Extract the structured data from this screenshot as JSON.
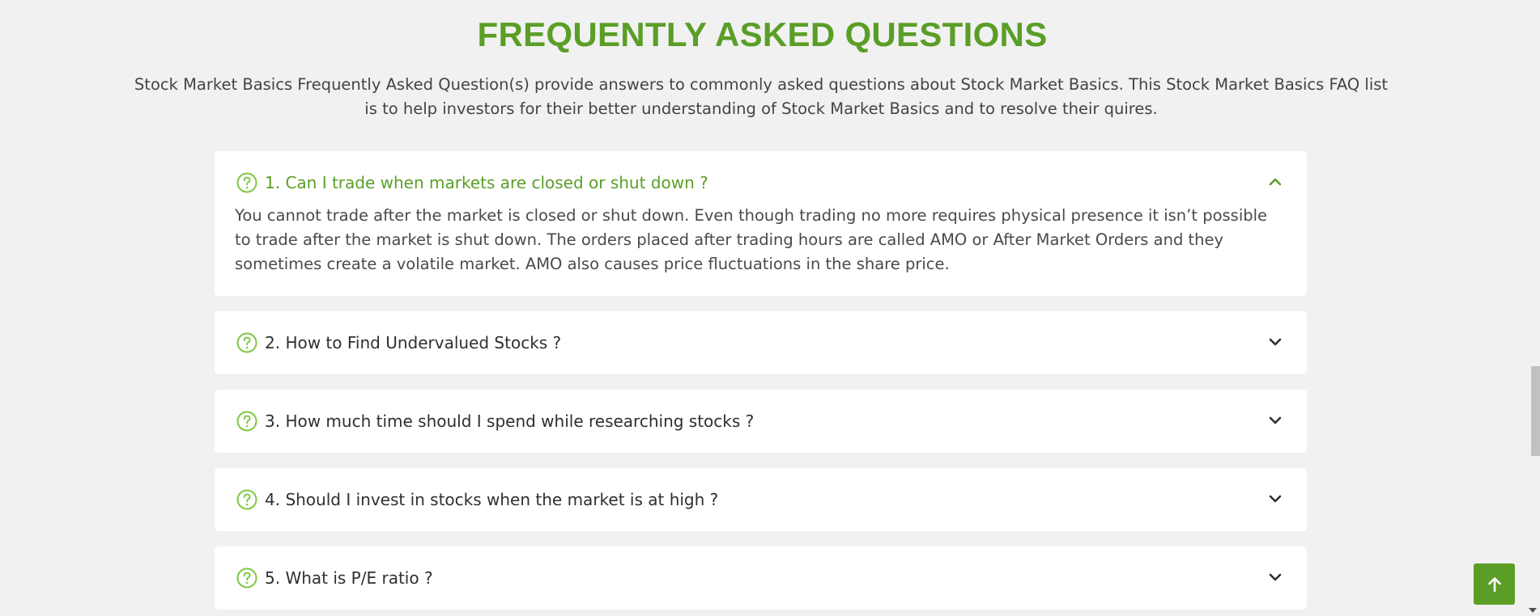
{
  "faq": {
    "title": "FREQUENTLY ASKED QUESTIONS",
    "intro": "Stock Market Basics Frequently Asked Question(s) provide answers to commonly asked questions about Stock Market Basics. This Stock Market Basics FAQ list is to help investors for their better understanding of Stock Market Basics and to resolve their quires.",
    "items": [
      {
        "question": "1. Can I trade when markets are closed or shut down ?",
        "answer": "You cannot trade after the market is closed or shut down. Even though trading no more requires physical presence it isn’t possible to trade after the market is shut down. The orders placed after trading hours are called AMO or After Market Orders and they sometimes create a volatile market. AMO also causes price fluctuations in the share price.",
        "expanded": true,
        "icon": "question-circle-icon",
        "toggle_icon": "chevron-up-icon"
      },
      {
        "question": "2. How to Find Undervalued Stocks ?",
        "expanded": false,
        "icon": "question-circle-icon",
        "toggle_icon": "chevron-down-icon"
      },
      {
        "question": "3. How much time should I spend while researching stocks ?",
        "expanded": false,
        "icon": "question-circle-icon",
        "toggle_icon": "chevron-down-icon"
      },
      {
        "question": "4. Should I invest in stocks when the market is at high ?",
        "expanded": false,
        "icon": "question-circle-icon",
        "toggle_icon": "chevron-down-icon"
      },
      {
        "question": "5. What is P/E ratio ?",
        "expanded": false,
        "icon": "question-circle-icon",
        "toggle_icon": "chevron-down-icon"
      }
    ]
  },
  "back_to_top": {
    "icon": "arrow-up-icon"
  },
  "colors": {
    "accent": "#5a9e27",
    "icon_light": "#7fc843",
    "background": "#f1f1f1",
    "card": "#ffffff",
    "text": "#2f2f2f"
  }
}
